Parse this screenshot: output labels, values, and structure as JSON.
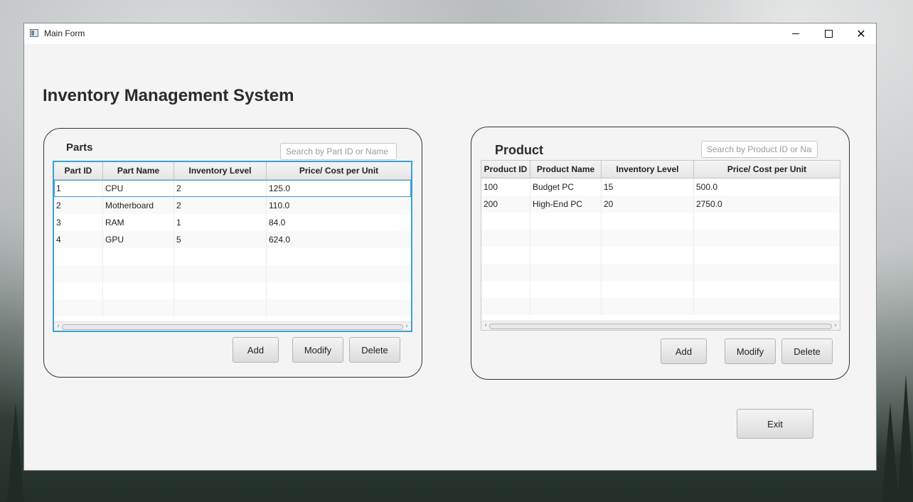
{
  "window": {
    "title": "Main Form"
  },
  "app": {
    "title": "Inventory Management System"
  },
  "parts": {
    "label": "Parts",
    "search_placeholder": "Search by Part ID or Name",
    "columns": [
      "Part ID",
      "Part Name",
      "Inventory Level",
      "Price/ Cost per Unit"
    ],
    "rows": [
      [
        "1",
        "CPU",
        "2",
        "125.0"
      ],
      [
        "2",
        "Motherboard",
        "2",
        "110.0"
      ],
      [
        "3",
        "RAM",
        "1",
        "84.0"
      ],
      [
        "4",
        "GPU",
        "5",
        "624.0"
      ]
    ],
    "buttons": {
      "add": "Add",
      "modify": "Modify",
      "delete": "Delete"
    }
  },
  "products": {
    "label": "Product",
    "search_placeholder": "Search by Product ID or Name",
    "columns": [
      "Product ID",
      "Product Name",
      "Inventory Level",
      "Price/ Cost per Unit"
    ],
    "rows": [
      [
        "100",
        "Budget PC",
        "15",
        "500.0"
      ],
      [
        "200",
        "High-End PC",
        "20",
        "2750.0"
      ]
    ],
    "buttons": {
      "add": "Add",
      "modify": "Modify",
      "delete": "Delete"
    }
  },
  "exit_label": "Exit",
  "colors": {
    "selection_border": "#3aa0d3",
    "window_bg": "#f4f4f4"
  },
  "icons": {
    "window_icon": "app-window-icon",
    "minimize": "minimize-icon",
    "maximize": "maximize-icon",
    "close": "close-icon"
  }
}
